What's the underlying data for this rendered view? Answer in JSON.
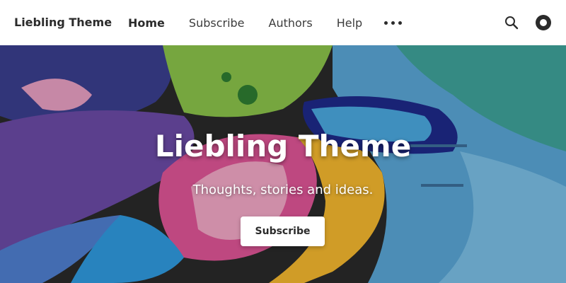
{
  "header": {
    "site_title": "Liebling Theme",
    "nav": [
      {
        "label": "Home",
        "active": true
      },
      {
        "label": "Subscribe",
        "active": false
      },
      {
        "label": "Authors",
        "active": false
      },
      {
        "label": "Help",
        "active": false
      }
    ],
    "more_icon": "more-dots-icon",
    "search_icon": "search-icon",
    "theme_toggle_icon": "theme-toggle-icon"
  },
  "hero": {
    "title": "Liebling Theme",
    "subtitle": "Thoughts, stories and ideas.",
    "button_label": "Subscribe",
    "background": "graffiti-mural-image"
  },
  "colors": {
    "header_bg": "#ffffff",
    "text_dark": "#2b2b2b",
    "button_bg": "#ffffff"
  }
}
